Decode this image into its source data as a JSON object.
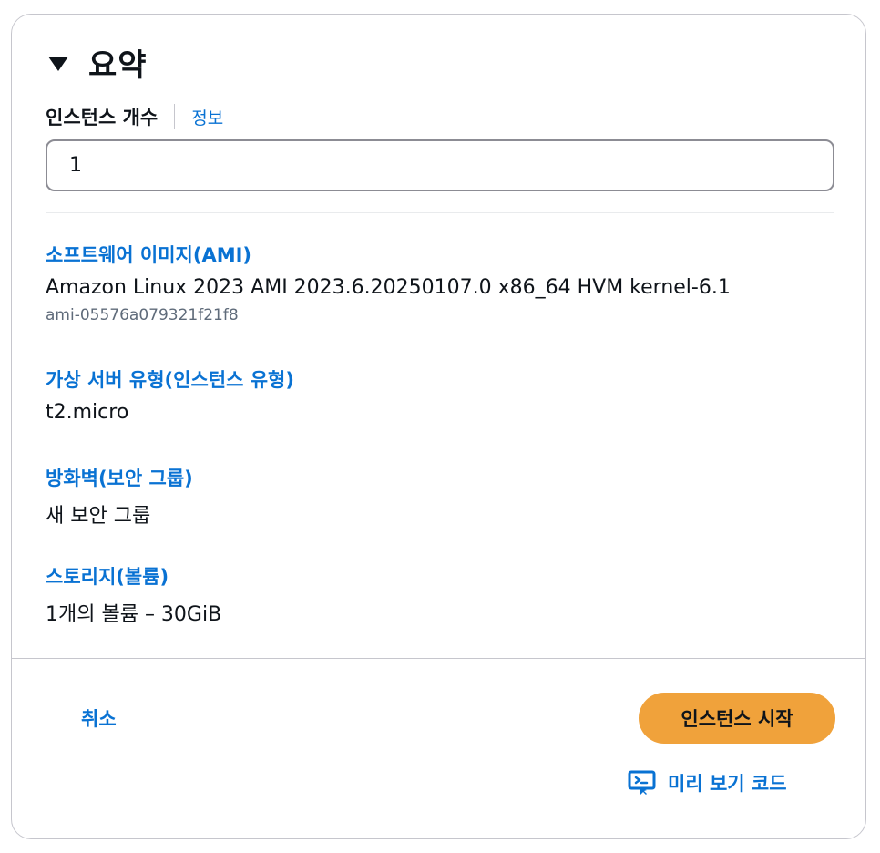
{
  "summary": {
    "title": "요약"
  },
  "instance_count": {
    "label": "인스턴스 개수",
    "info_link": "정보",
    "value": "1"
  },
  "ami": {
    "label": "소프트웨어 이미지(AMI)",
    "value": "Amazon Linux 2023 AMI 2023.6.20250107.0 x86_64 HVM kernel-6.1",
    "id": "ami-05576a079321f21f8"
  },
  "instance_type": {
    "label": "가상 서버 유형(인스턴스 유형)",
    "value": "t2.micro"
  },
  "firewall": {
    "label": "방화벽(보안 그룹)",
    "value": "새 보안 그룹"
  },
  "storage": {
    "label": "스토리지(볼륨)",
    "value": "1개의 볼륨 – 30GiB"
  },
  "actions": {
    "cancel_label": "취소",
    "launch_label": "인스턴스 시작",
    "preview_label": "미리 보기 코드"
  },
  "colors": {
    "link": "#0972d3",
    "primary_button": "#f0a23b",
    "text": "#0f141a",
    "muted": "#5f6b7a"
  },
  "icons": {
    "collapse": "caret-down-icon",
    "preview": "code-preview-icon"
  }
}
